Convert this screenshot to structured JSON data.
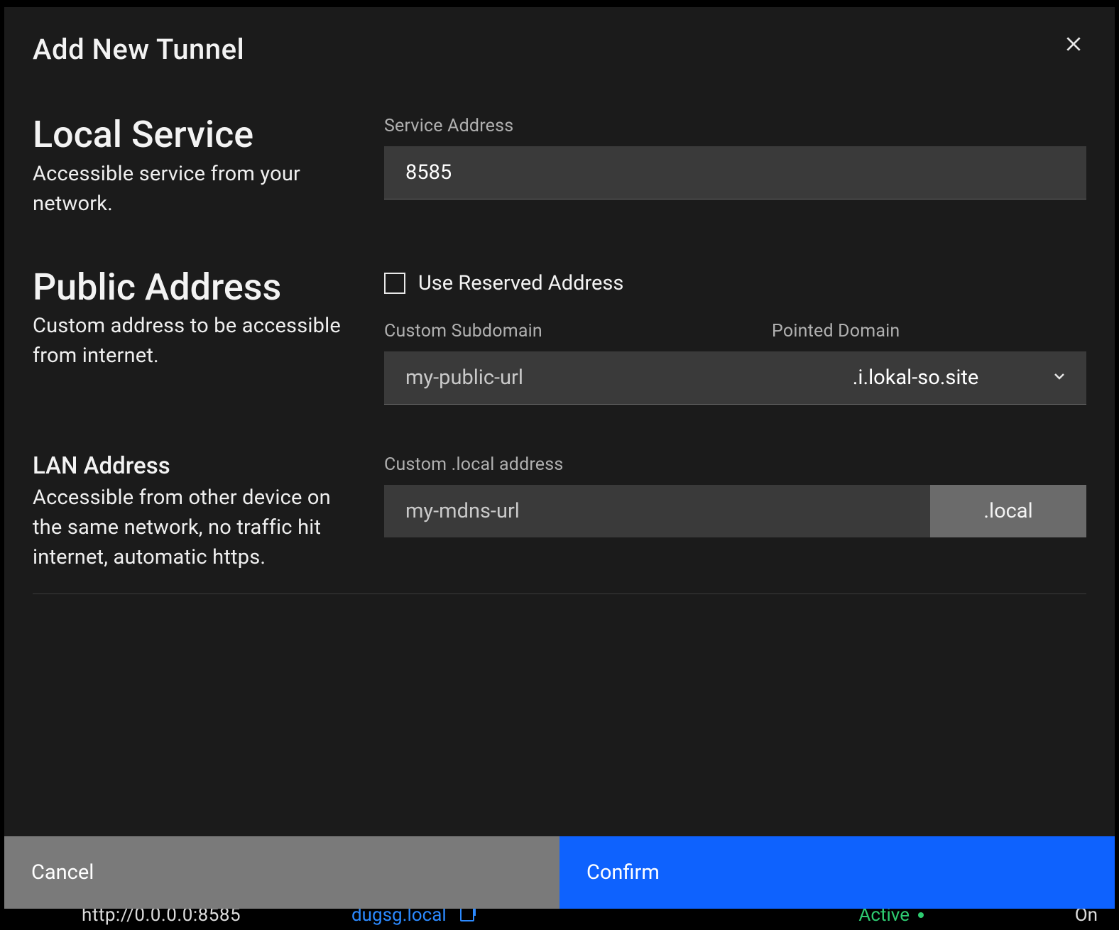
{
  "modal": {
    "title": "Add New Tunnel"
  },
  "local": {
    "title": "Local Service",
    "desc": "Accessible service from your network.",
    "service_address_label": "Service Address",
    "service_address_value": "8585"
  },
  "public": {
    "title": "Public Address",
    "desc": "Custom address to be accessible from internet.",
    "use_reserved_label": "Use Reserved Address",
    "subdomain_label": "Custom Subdomain",
    "subdomain_placeholder": "my-public-url",
    "pointed_domain_label": "Pointed Domain",
    "pointed_domain_value": ".i.lokal-so.site"
  },
  "lan": {
    "title": "LAN Address",
    "desc": "Accessible from other device on the same network, no traffic hit internet, automatic https.",
    "label": "Custom .local address",
    "placeholder": "my-mdns-url",
    "suffix": ".local"
  },
  "footer": {
    "cancel": "Cancel",
    "confirm": "Confirm"
  },
  "background": {
    "url": "http://0.0.0.0:8585",
    "lan_host": "dugsg.local",
    "status": "Active",
    "on": "On"
  }
}
